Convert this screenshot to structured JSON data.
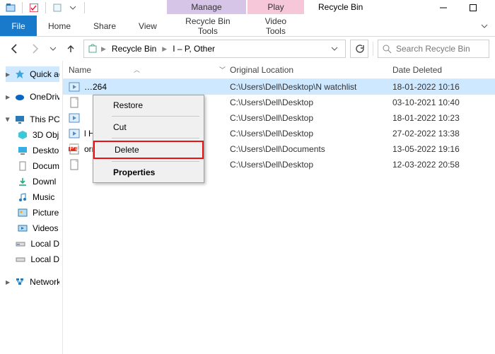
{
  "window": {
    "title": "Recycle Bin"
  },
  "context_groups": {
    "manage": "Manage",
    "play": "Play"
  },
  "tabs": {
    "file": "File",
    "home": "Home",
    "share": "Share",
    "view": "View",
    "recycle_tools": "Recycle Bin Tools",
    "video_tools": "Video Tools"
  },
  "breadcrumb": {
    "items": [
      "Recycle Bin",
      "I – P, Other"
    ]
  },
  "search": {
    "placeholder": "Search Recycle Bin"
  },
  "sidebar": {
    "items": [
      {
        "label": "Quick ac",
        "icon": "quickaccess",
        "sel": true
      },
      {
        "label": "OneDriv",
        "icon": "onedrive"
      },
      {
        "label": "This PC",
        "icon": "thispc",
        "expandable": true
      },
      {
        "label": "3D Obj",
        "icon": "3d"
      },
      {
        "label": "Deskto",
        "icon": "desktop"
      },
      {
        "label": "Docum",
        "icon": "documents"
      },
      {
        "label": "Downl",
        "icon": "downloads"
      },
      {
        "label": "Music",
        "icon": "music"
      },
      {
        "label": "Picture",
        "icon": "pictures"
      },
      {
        "label": "Videos",
        "icon": "videos"
      },
      {
        "label": "Local D",
        "icon": "drive"
      },
      {
        "label": "Local D",
        "icon": "drive"
      },
      {
        "label": "Network",
        "icon": "network",
        "expandable": true
      }
    ]
  },
  "columns": {
    "name": "Name",
    "orig": "Original Location",
    "date": "Date Deleted"
  },
  "rows": [
    {
      "name": "…264",
      "orig": "C:\\Users\\Dell\\Desktop\\N watchlist",
      "date": "18-01-2022 10:16",
      "sel": true,
      "icon": "video"
    },
    {
      "name": "",
      "orig": "C:\\Users\\Dell\\Desktop",
      "date": "03-10-2021 10:40",
      "icon": "file"
    },
    {
      "name": "",
      "orig": "C:\\Users\\Dell\\Desktop",
      "date": "18-01-2022 10:23",
      "icon": "video"
    },
    {
      "name": "l H...",
      "orig": "C:\\Users\\Dell\\Desktop",
      "date": "27-02-2022 13:38",
      "icon": "video"
    },
    {
      "name": "orm...",
      "orig": "C:\\Users\\Dell\\Documents",
      "date": "13-05-2022 19:16",
      "icon": "pdf"
    },
    {
      "name": "",
      "orig": "C:\\Users\\Dell\\Desktop",
      "date": "12-03-2022 20:58",
      "icon": "file"
    }
  ],
  "context_menu": {
    "restore": "Restore",
    "cut": "Cut",
    "delete": "Delete",
    "properties": "Properties"
  }
}
